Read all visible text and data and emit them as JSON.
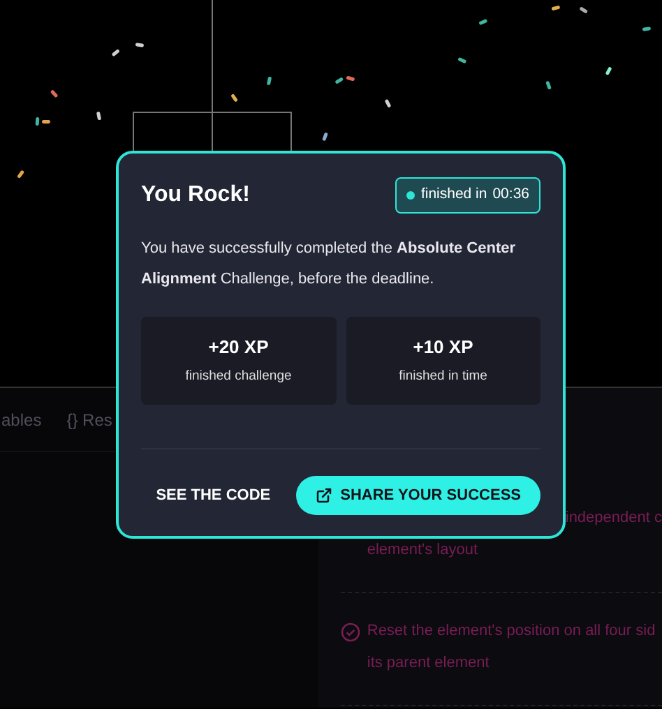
{
  "editor_tabs": [
    {
      "label": "ables",
      "selected": false
    },
    {
      "label": "{} Res",
      "selected": false
    }
  ],
  "checklist": [
    {
      "kind": "partial",
      "lines": [
        "independent c",
        "element's layout"
      ]
    },
    {
      "kind": "full",
      "lines": [
        "Reset the element's position on all four sid",
        "its parent element"
      ],
      "checked": true
    }
  ],
  "modal": {
    "title": "You Rock!",
    "badge": {
      "label": "finished in",
      "time": "00:36"
    },
    "message": "You have successfully completed the **Absolute Center Alignment** Challenge, before the deadline.",
    "stats": [
      {
        "value": "+20 XP",
        "label": "finished challenge"
      },
      {
        "value": "+10 XP",
        "label": "finished in time"
      }
    ],
    "buttons": [
      {
        "label": "SEE THE CODE",
        "kind": "text"
      },
      {
        "label": "SHARE YOUR SUCCESS",
        "kind": "primary"
      }
    ]
  }
}
